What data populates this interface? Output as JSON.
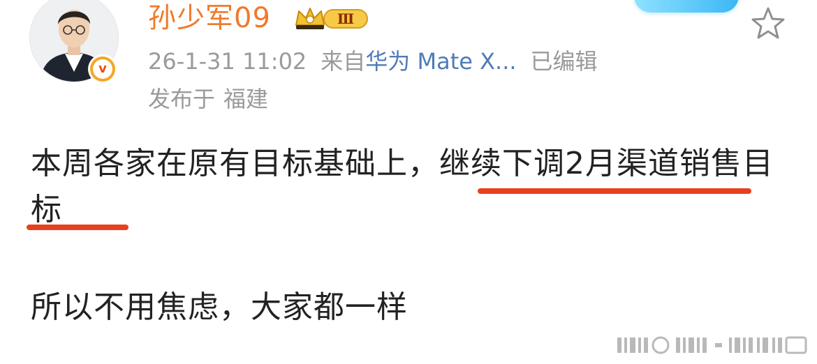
{
  "post": {
    "username": "孙少军09",
    "vip_level_text": "Ⅲ",
    "verified_symbol": "v",
    "meta": {
      "timestamp": "26-1-31 11:02",
      "from_label": "来自",
      "device": "华为 Mate X...",
      "edited": "已编辑"
    },
    "location": {
      "label": "发布于",
      "place": "福建"
    },
    "content": {
      "line1_plain": "本周各家在原有目标基础上，",
      "line1_highlight": "继续下调2月渠道销售目标",
      "line2": "所以不用焦虑，大家都一样"
    }
  },
  "colors": {
    "username": "#f07a2a",
    "device_link": "#4f7bb8",
    "meta_gray": "#9a9a9a",
    "underline": "#e8401c",
    "verified_gold": "#f5a623"
  },
  "icons": {
    "star": "star-icon",
    "crown": "crown-icon",
    "verified": "verified-icon"
  }
}
